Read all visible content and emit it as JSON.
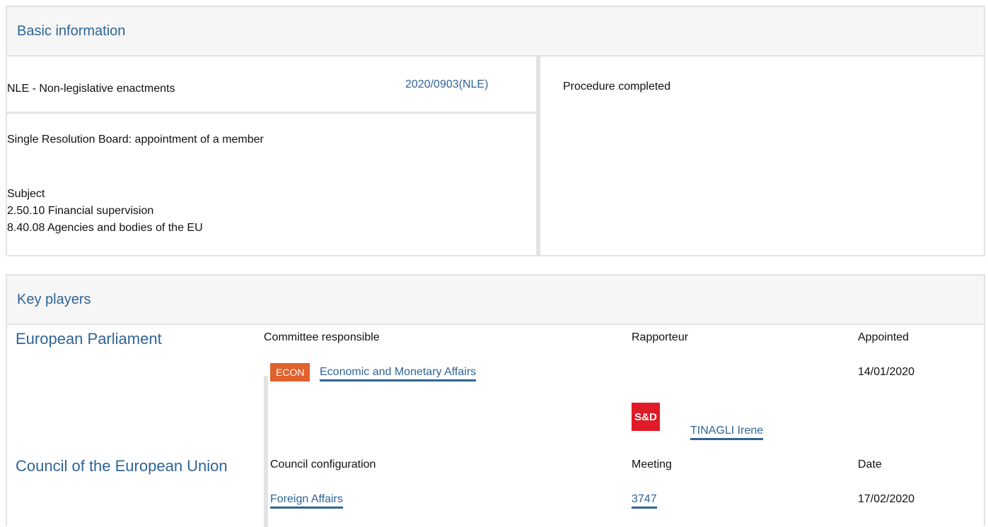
{
  "basic": {
    "title": "Basic information",
    "procedure_type": "NLE - Non-legislative enactments",
    "procedure_ref": "2020/0903(NLE)",
    "status": "Procedure completed",
    "procedure_title": "Single Resolution Board: appointment of a member",
    "subject_label": "Subject",
    "subjects": [
      "2.50.10 Financial supervision",
      "8.40.08 Agencies and bodies of the EU"
    ]
  },
  "key_players": {
    "title": "Key players",
    "parliament": {
      "org": "European Parliament",
      "headers": [
        "Committee responsible",
        "Rapporteur",
        "Appointed"
      ],
      "committee_badge": "ECON",
      "committee": "Economic and Monetary Affairs",
      "appointed": "14/01/2020",
      "group_logo": "S&D",
      "rapporteur": "TINAGLI Irene"
    },
    "council": {
      "org": "Council of the European Union",
      "headers": [
        "Council configuration",
        "Meeting",
        "Date"
      ],
      "configuration": "Foreign Affairs",
      "meeting": "3747",
      "date": "17/02/2020"
    }
  },
  "colors": {
    "accent": "#2f6496",
    "badge": "#e0612c",
    "sd_red": "#e01a26"
  }
}
